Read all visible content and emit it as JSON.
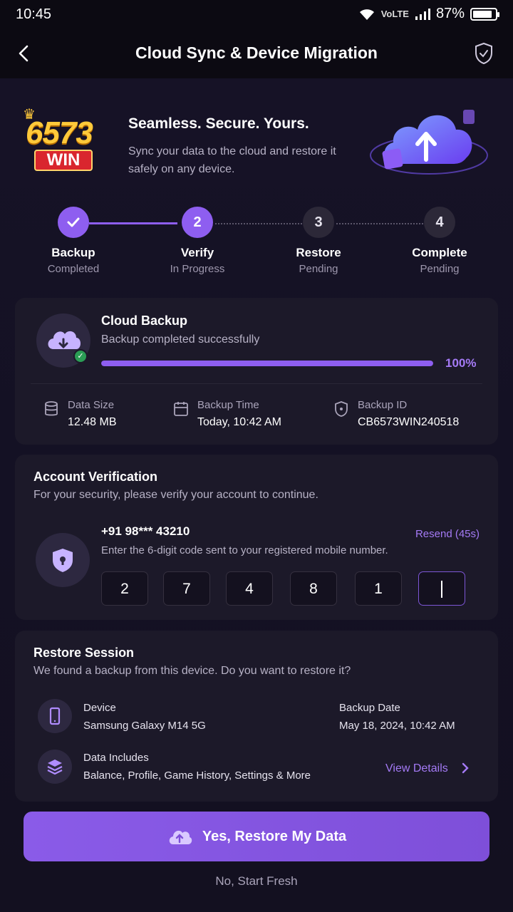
{
  "status_bar": {
    "time": "10:45",
    "network": "VoLTE",
    "battery": "87%"
  },
  "header": {
    "title": "Cloud Sync & Device Migration"
  },
  "brand": {
    "logo_number": "6573",
    "logo_word": "WIN"
  },
  "hero": {
    "title": "Seamless. Secure. Yours.",
    "subtitle": "Sync your data to the cloud and restore it safely on any device."
  },
  "steps": [
    {
      "number": "",
      "label": "Backup",
      "status": "Completed"
    },
    {
      "number": "2",
      "label": "Verify",
      "status": "In Progress"
    },
    {
      "number": "3",
      "label": "Restore",
      "status": "Pending"
    },
    {
      "number": "4",
      "label": "Complete",
      "status": "Pending"
    }
  ],
  "cloud_backup": {
    "title": "Cloud Backup",
    "subtitle": "Backup completed successfully",
    "progress_percent": 100,
    "progress_label": "100%",
    "meta": [
      {
        "label": "Data Size",
        "value": "12.48 MB",
        "icon": "database-icon"
      },
      {
        "label": "Backup Time",
        "value": "Today, 10:42 AM",
        "icon": "calendar-icon"
      },
      {
        "label": "Backup ID",
        "value": "CB6573WIN240518",
        "icon": "shield-icon"
      }
    ]
  },
  "verification": {
    "title": "Account Verification",
    "subtitle": "For your security, please verify your account to continue.",
    "phone": "+91 98*** 43210",
    "resend": "Resend (45s)",
    "hint": "Enter the 6-digit code sent to your registered mobile number.",
    "otp": [
      "2",
      "7",
      "4",
      "8",
      "1",
      ""
    ]
  },
  "restore": {
    "title": "Restore Session",
    "subtitle": "We found a backup from this device. Do you want to restore it?",
    "device_label": "Device",
    "device_value": "Samsung Galaxy M14 5G",
    "date_label": "Backup Date",
    "date_value": "May 18, 2024, 10:42 AM",
    "includes_label": "Data Includes",
    "includes_value": "Balance, Profile, Game History, Settings & More",
    "view_details": "View Details"
  },
  "actions": {
    "primary": "Yes, Restore My Data",
    "secondary": "No, Start Fresh"
  },
  "colors": {
    "accent": "#8e5ef0",
    "success": "#2b9d55",
    "background": "#14111f"
  }
}
